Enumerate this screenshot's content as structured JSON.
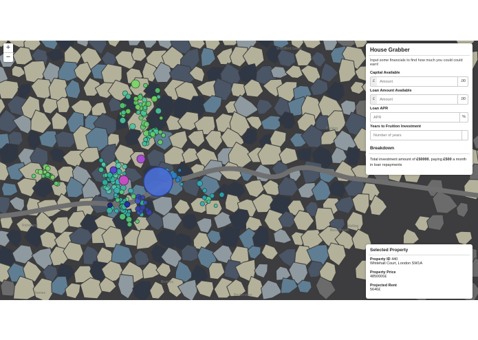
{
  "map": {
    "zoom_in": "+",
    "zoom_out": "−",
    "labels": [
      "Woodford Green",
      "Barking",
      "Richmond",
      "Stratford",
      "Welling",
      "Bromley",
      "Beckenham",
      "Thames",
      "Croydon",
      "Erith",
      "Bexleyheath",
      "Dartford",
      "Sidcup",
      "Epsom",
      "Tottenham",
      "Enfield"
    ]
  },
  "calculator": {
    "title": "House Grabber",
    "intro": "Input some financials to find how much you could could earn!",
    "capital_label": "Capital Available",
    "capital_prefix": "£",
    "capital_placeholder": "Amount",
    "capital_suffix": ".00",
    "loan_label": "Loan Amount Available",
    "loan_prefix": "£",
    "loan_placeholder": "Amount",
    "loan_suffix": ".00",
    "apr_label": "Loan APR",
    "apr_placeholder": "APR",
    "apr_suffix": "%",
    "years_label": "Years to Fruition Investment",
    "years_placeholder": "Number of years",
    "breakdown_title": "Breakdown",
    "breakdown_pre": "Total investment amount of ",
    "breakdown_amount": "£50000",
    "breakdown_mid": ", paying ",
    "breakdown_payment": "£500",
    "breakdown_post": " a month in loan repayments"
  },
  "selected": {
    "title": "Selected Property",
    "id_label": "Property ID",
    "id_value": "440",
    "address": "Whitehall Court, London SW1A",
    "price_label": "Property Price",
    "price_value": "4850000£",
    "rent_label": "Projected Rent",
    "rent_value": "5640£"
  },
  "colors": {
    "map_base": "#3d3d3f",
    "region_light": "#b3b19a",
    "region_blue": "#5f7e93",
    "region_dark": "#2f3644",
    "river": "#6f6f70"
  }
}
